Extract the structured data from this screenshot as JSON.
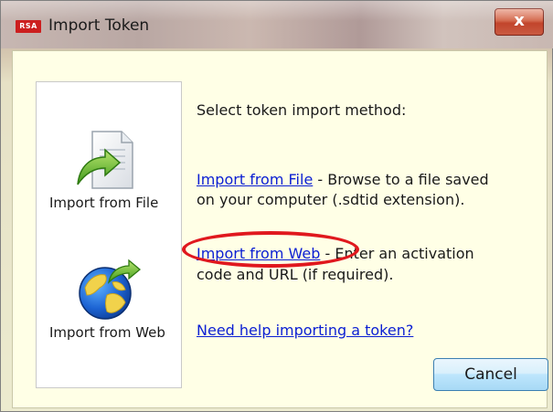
{
  "window": {
    "title": "Import Token",
    "logo_text": "RSA",
    "close_label": "x"
  },
  "left_panel": {
    "file_label": "Import from File",
    "web_label": "Import from Web",
    "file_icon": "document-arrow-icon",
    "web_icon": "globe-arrow-icon"
  },
  "main": {
    "heading": "Select token import method:",
    "file_link": "Import from File",
    "file_desc_line1": " - Browse to a file saved",
    "file_desc_line2": "on your computer (.sdtid extension).",
    "web_link": "Import from Web",
    "web_desc_line1": " - Enter an activation",
    "web_desc_line2": "code and URL (if required).",
    "help_link": "Need help importing a token?"
  },
  "buttons": {
    "cancel": "Cancel"
  },
  "colors": {
    "link": "#0b1fd3",
    "highlight_oval": "#e0181e",
    "content_bg": "#ffffe6"
  }
}
